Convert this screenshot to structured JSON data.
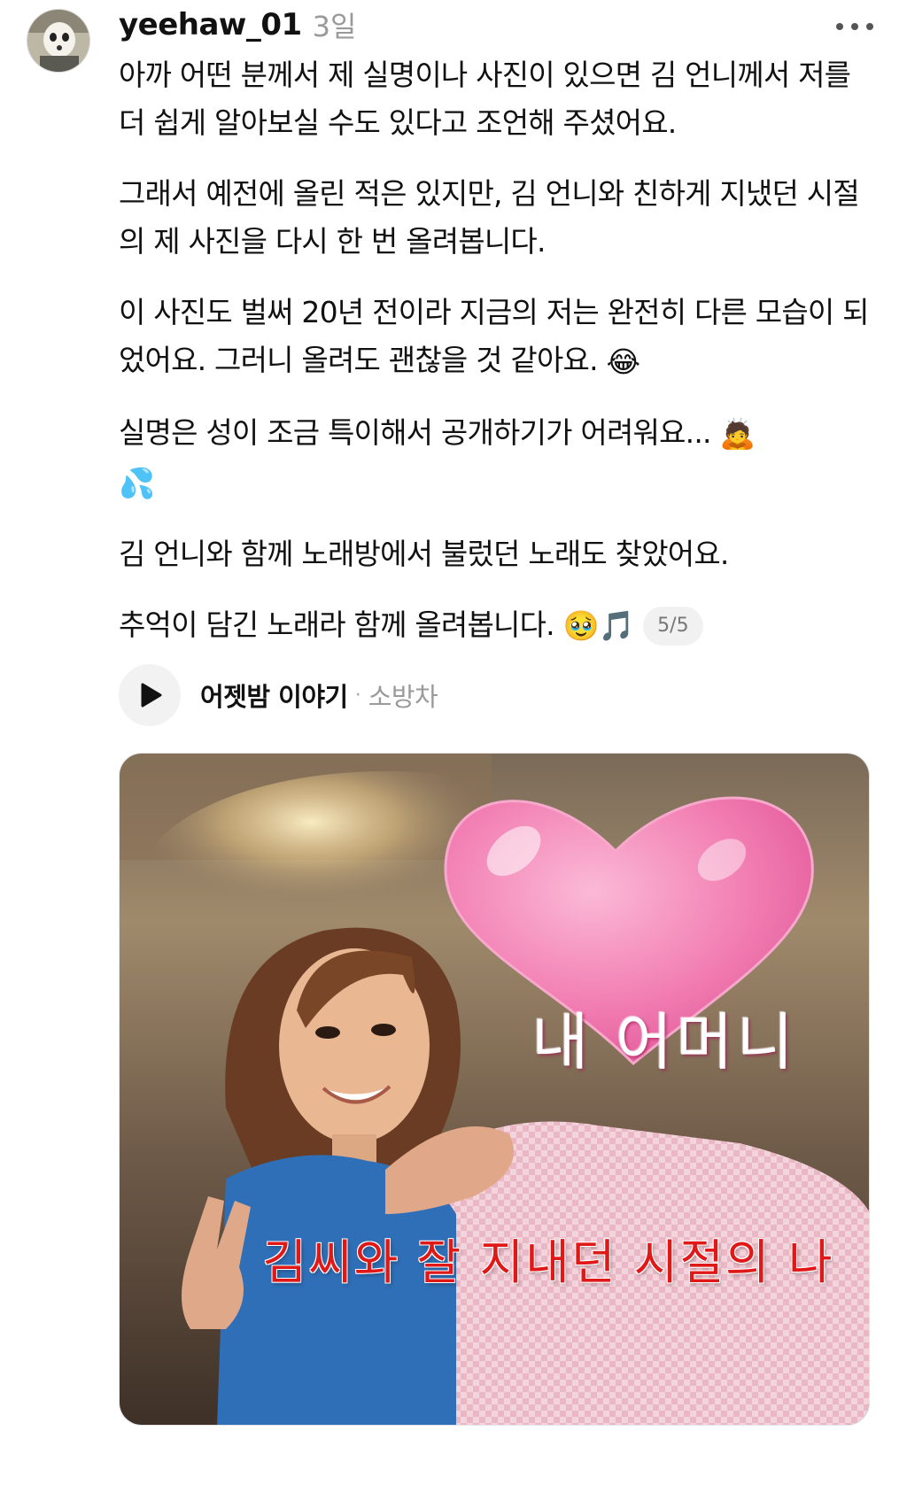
{
  "post": {
    "username": "yeehaw_01",
    "timestamp": "3일",
    "avatar_icon": "ghost-mask-avatar",
    "more_icon": "more-dots-icon",
    "paragraphs": [
      "아까 어떤 분께서 제 실명이나 사진이 있으면 김 언니께서 저를 더 쉽게 알아보실 수도 있다고 조언해 주셨어요.",
      "그래서 예전에 올린 적은 있지만, 김 언니와 친하게 지냈던 시절의 제 사진을 다시 한 번 올려봅니다.",
      "이 사진도 벌써 20년 전이라 지금의 저는 완전히 다른 모습이 되었어요. 그러니 올려도 괜찮을 것 같아요.",
      "실명은 성이 조금 특이해서 공개하기가 어려워요...",
      "김 언니와 함께 노래방에서 불렀던 노래도 찾았어요.",
      "추억이 담긴 노래라 함께 올려봅니다."
    ],
    "emojis": {
      "laughing": "😂",
      "bowing": "🙇",
      "sweat": "💦",
      "pleading": "🥹",
      "music": "🎵"
    },
    "page_counter": "5/5"
  },
  "music": {
    "play_icon": "play-icon",
    "title": "어젯밤 이야기",
    "separator": "·",
    "artist": "소방차"
  },
  "photo": {
    "heart_text": "내 어머니",
    "caption": "김씨와 잘 지내던 시절의 나",
    "heart_color": "#f27fb3",
    "caption_color": "#e01818"
  }
}
